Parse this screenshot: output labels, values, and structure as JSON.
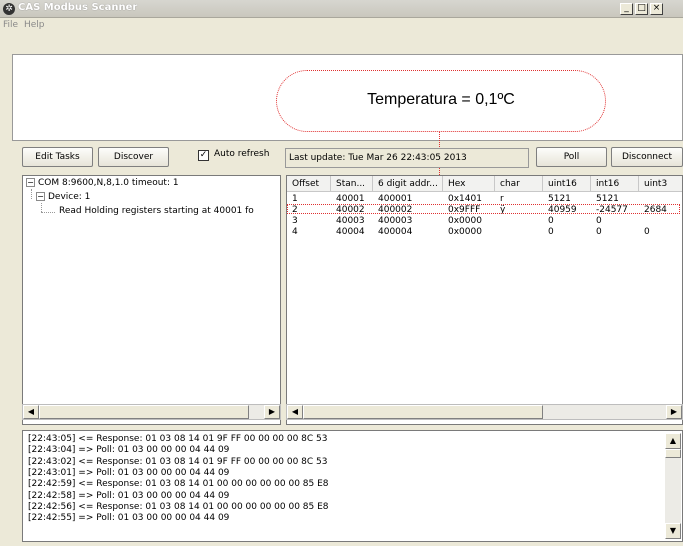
{
  "window": {
    "title": "CAS Modbus Scanner",
    "icon": "cas-logo-icon",
    "controls": [
      "minimize",
      "maximize",
      "close"
    ]
  },
  "menu": {
    "items": [
      "File",
      "Help"
    ]
  },
  "display": {
    "value_text": "Temperatura = 0,1ºC"
  },
  "toolbar": {
    "edit_tasks": "Edit Tasks",
    "discover": "Discover",
    "auto_refresh_label": "Auto refresh",
    "auto_refresh_checked": true,
    "last_update": "Last update: Tue Mar 26 22:43:05 2013",
    "poll": "Poll",
    "disconnect": "Disconnect"
  },
  "tree": {
    "root": "COM 8:9600,N,8,1.0 timeout: 1",
    "device": "Device: 1",
    "task": "Read Holding registers starting at 40001 fo"
  },
  "grid": {
    "columns": [
      "Offset",
      "Stan...",
      "6 digit addr...",
      "Hex",
      "char",
      "uint16",
      "int16",
      "uint3"
    ],
    "rows": [
      [
        "1",
        "40001",
        "400001",
        "0x1401",
        "r",
        "5121",
        "5121",
        ""
      ],
      [
        "2",
        "40002",
        "400002",
        "0x9FFF",
        "ÿ",
        "40959",
        "-24577",
        "2684"
      ],
      [
        "3",
        "40003",
        "400003",
        "0x0000",
        "",
        "0",
        "0",
        ""
      ],
      [
        "4",
        "40004",
        "400004",
        "0x0000",
        "",
        "0",
        "0",
        "0"
      ]
    ]
  },
  "log": {
    "lines": [
      "[22:43:05] <= Response: 01 03 08 14 01 9F FF 00 00 00 00 8C 53",
      "[22:43:04] => Poll: 01 03 00 00 00 04 44 09",
      "[22:43:02] <= Response: 01 03 08 14 01 9F FF 00 00 00 00 8C 53",
      "[22:43:01] => Poll: 01 03 00 00 00 04 44 09",
      "[22:42:59] <= Response: 01 03 08 14 01 00 00 00 00 00 00 85 E8",
      "[22:42:58] => Poll: 01 03 00 00 00 04 44 09",
      "[22:42:56] <= Response: 01 03 08 14 01 00 00 00 00 00 00 85 E8",
      "[22:42:55] => Poll: 01 03 00 00 00 04 44 09"
    ]
  },
  "colors": {
    "annotation": "#e03030",
    "window_bg": "#ece9d8"
  }
}
